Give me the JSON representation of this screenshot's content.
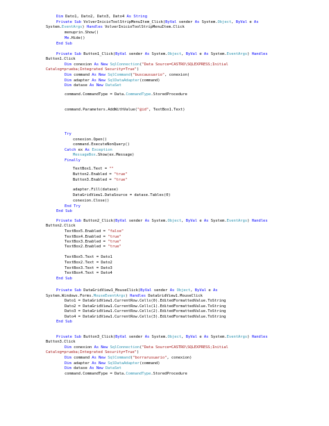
{
  "colors": {
    "background": "#ffffff",
    "plain": "#000000",
    "keyword": "#0000ff",
    "type": "#2b91af",
    "string": "#a31515"
  },
  "code": {
    "lines": [
      [
        {
          "k": "k",
          "t": "Dim"
        },
        {
          "k": "p",
          "t": " Dato1, Dato2, Dato3, Dato4 "
        },
        {
          "k": "k",
          "t": "As String"
        }
      ],
      [
        {
          "k": "k",
          "t": "Private Sub"
        },
        {
          "k": "p",
          "t": " VolverInicioToolStripMenuItem_Click("
        },
        {
          "k": "k",
          "t": "ByVal"
        },
        {
          "k": "p",
          "t": " sender "
        },
        {
          "k": "k",
          "t": "As"
        },
        {
          "k": "p",
          "t": " System."
        },
        {
          "k": "t",
          "t": "Object"
        },
        {
          "k": "p",
          "t": ", "
        },
        {
          "k": "k",
          "t": "ByVal"
        },
        {
          "k": "p",
          "t": " e "
        },
        {
          "k": "k",
          "t": "As"
        }
      ],
      [
        {
          "k": "p",
          "t": "System."
        },
        {
          "k": "t",
          "t": "EventArgs"
        },
        {
          "k": "p",
          "t": ") "
        },
        {
          "k": "k",
          "t": "Handles"
        },
        {
          "k": "p",
          "t": " VolverInicioToolStripMenuItem.Click"
        }
      ],
      [
        {
          "k": "p",
          "t": "menuprin.Show()"
        }
      ],
      [
        {
          "k": "k",
          "t": "Me"
        },
        {
          "k": "p",
          "t": ".Hide()"
        }
      ],
      [
        {
          "k": "k",
          "t": "End Sub"
        }
      ],
      [
        {
          "k": "k",
          "t": "Private Sub"
        },
        {
          "k": "p",
          "t": " Button1_Click("
        },
        {
          "k": "k",
          "t": "ByVal"
        },
        {
          "k": "p",
          "t": " sender "
        },
        {
          "k": "k",
          "t": "As"
        },
        {
          "k": "p",
          "t": " System."
        },
        {
          "k": "t",
          "t": "Object"
        },
        {
          "k": "p",
          "t": ", "
        },
        {
          "k": "k",
          "t": "ByVal"
        },
        {
          "k": "p",
          "t": " e "
        },
        {
          "k": "k",
          "t": "As"
        },
        {
          "k": "p",
          "t": " System."
        },
        {
          "k": "t",
          "t": "EventArgs"
        },
        {
          "k": "p",
          "t": ") "
        },
        {
          "k": "k",
          "t": "Handles"
        }
      ],
      [
        {
          "k": "p",
          "t": "Button1.Click"
        }
      ],
      [
        {
          "k": "k",
          "t": "Dim"
        },
        {
          "k": "p",
          "t": " conexion "
        },
        {
          "k": "k",
          "t": "As New"
        },
        {
          "k": "p",
          "t": " "
        },
        {
          "k": "t",
          "t": "SqlConnection"
        },
        {
          "k": "p",
          "t": "("
        },
        {
          "k": "s",
          "t": "\"Data Source=CASTRO\\SQLEXPRESS;Initial"
        }
      ],
      [
        {
          "k": "s",
          "t": "Catalog=prueba;Integrated Security=True\""
        },
        {
          "k": "p",
          "t": ")"
        }
      ],
      [
        {
          "k": "k",
          "t": "Dim"
        },
        {
          "k": "p",
          "t": " command "
        },
        {
          "k": "k",
          "t": "As New"
        },
        {
          "k": "p",
          "t": " "
        },
        {
          "k": "t",
          "t": "SqlCommand"
        },
        {
          "k": "p",
          "t": "("
        },
        {
          "k": "s",
          "t": "\"buscausuario\""
        },
        {
          "k": "p",
          "t": ", conexion)"
        }
      ],
      [
        {
          "k": "k",
          "t": "Dim"
        },
        {
          "k": "p",
          "t": " adapter "
        },
        {
          "k": "k",
          "t": "As New"
        },
        {
          "k": "p",
          "t": " "
        },
        {
          "k": "t",
          "t": "SqlDataAdapter"
        },
        {
          "k": "p",
          "t": "(command)"
        }
      ],
      [
        {
          "k": "k",
          "t": "Dim"
        },
        {
          "k": "p",
          "t": " datase "
        },
        {
          "k": "k",
          "t": "As New"
        },
        {
          "k": "p",
          "t": " "
        },
        {
          "k": "t",
          "t": "DataSet"
        }
      ],
      [
        {
          "k": "p",
          "t": "command.CommandType = Data."
        },
        {
          "k": "t",
          "t": "CommandType"
        },
        {
          "k": "p",
          "t": ".StoredProcedure"
        }
      ],
      [
        {
          "k": "p",
          "t": "command.Parameters.AddWithValue("
        },
        {
          "k": "s",
          "t": "\"@id\""
        },
        {
          "k": "p",
          "t": ", TextBox1.Text)"
        }
      ],
      [
        {
          "k": "k",
          "t": "Try"
        }
      ],
      [
        {
          "k": "p",
          "t": "conexion.Open()"
        }
      ],
      [
        {
          "k": "p",
          "t": "command.ExecuteNonQuery()"
        }
      ],
      [
        {
          "k": "k",
          "t": "Catch"
        },
        {
          "k": "p",
          "t": " ex "
        },
        {
          "k": "k",
          "t": "As"
        },
        {
          "k": "p",
          "t": " "
        },
        {
          "k": "t",
          "t": "Exception"
        }
      ],
      [
        {
          "k": "t",
          "t": "MessageBox"
        },
        {
          "k": "p",
          "t": ".Show(ex.Message)"
        }
      ],
      [
        {
          "k": "k",
          "t": "Finally"
        }
      ],
      [
        {
          "k": "p",
          "t": "TextBox1.Text = "
        },
        {
          "k": "s",
          "t": "\"\""
        }
      ],
      [
        {
          "k": "p",
          "t": "Button2.Enabled = "
        },
        {
          "k": "s",
          "t": "\"true\""
        }
      ],
      [
        {
          "k": "p",
          "t": "Button3.Enabled = "
        },
        {
          "k": "s",
          "t": "\"true\""
        }
      ],
      [
        {
          "k": "p",
          "t": "adapter.Fill(datase)"
        }
      ],
      [
        {
          "k": "p",
          "t": "DataGridView1.DataSource = datase.Tables(0)"
        }
      ],
      [
        {
          "k": "p",
          "t": "conexion.Close()"
        }
      ],
      [
        {
          "k": "k",
          "t": "End Try"
        }
      ],
      [
        {
          "k": "k",
          "t": "End Sub"
        }
      ],
      [
        {
          "k": "k",
          "t": "Private Sub"
        },
        {
          "k": "p",
          "t": " Button2_Click("
        },
        {
          "k": "k",
          "t": "ByVal"
        },
        {
          "k": "p",
          "t": " sender "
        },
        {
          "k": "k",
          "t": "As"
        },
        {
          "k": "p",
          "t": " System."
        },
        {
          "k": "t",
          "t": "Object"
        },
        {
          "k": "p",
          "t": ", "
        },
        {
          "k": "k",
          "t": "ByVal"
        },
        {
          "k": "p",
          "t": " e "
        },
        {
          "k": "k",
          "t": "As"
        },
        {
          "k": "p",
          "t": " System."
        },
        {
          "k": "t",
          "t": "EventArgs"
        },
        {
          "k": "p",
          "t": ") "
        },
        {
          "k": "k",
          "t": "Handles"
        }
      ],
      [
        {
          "k": "p",
          "t": "Button2.Click"
        }
      ],
      [
        {
          "k": "p",
          "t": "TextBox5.Enabled = "
        },
        {
          "k": "s",
          "t": "\"false\""
        }
      ],
      [
        {
          "k": "p",
          "t": "TextBox4.Enabled = "
        },
        {
          "k": "s",
          "t": "\"true\""
        }
      ],
      [
        {
          "k": "p",
          "t": "TextBox3.Enabled = "
        },
        {
          "k": "s",
          "t": "\"true\""
        }
      ],
      [
        {
          "k": "p",
          "t": "TextBox2.Enabled = "
        },
        {
          "k": "s",
          "t": "\"true\""
        }
      ],
      [
        {
          "k": "p",
          "t": "TextBox5.Text = Dato1"
        }
      ],
      [
        {
          "k": "p",
          "t": "TextBox2.Text = Dato2"
        }
      ],
      [
        {
          "k": "p",
          "t": "TextBox3.Text = Dato3"
        }
      ],
      [
        {
          "k": "p",
          "t": "TextBox4.Text = Dato4"
        }
      ],
      [
        {
          "k": "k",
          "t": "End Sub"
        }
      ],
      [
        {
          "k": "k",
          "t": "Private Sub"
        },
        {
          "k": "p",
          "t": " DataGridView1_MouseClick("
        },
        {
          "k": "k",
          "t": "ByVal"
        },
        {
          "k": "p",
          "t": " sender "
        },
        {
          "k": "k",
          "t": "As"
        },
        {
          "k": "p",
          "t": " "
        },
        {
          "k": "t",
          "t": "Object"
        },
        {
          "k": "p",
          "t": ", "
        },
        {
          "k": "k",
          "t": "ByVal"
        },
        {
          "k": "p",
          "t": " e "
        },
        {
          "k": "k",
          "t": "As"
        }
      ],
      [
        {
          "k": "p",
          "t": "System.Windows.Forms."
        },
        {
          "k": "t",
          "t": "MouseEventArgs"
        },
        {
          "k": "p",
          "t": ") "
        },
        {
          "k": "k",
          "t": "Handles"
        },
        {
          "k": "p",
          "t": " DataGridView1.MouseClick"
        }
      ],
      [
        {
          "k": "p",
          "t": "Dato1 = DataGridView1.CurrentRow.Cells(0).EditedFormattedValue.ToString"
        }
      ],
      [
        {
          "k": "p",
          "t": "Dato2 = DataGridView1.CurrentRow.Cells(1).EditedFormattedValue.ToString"
        }
      ],
      [
        {
          "k": "p",
          "t": "Dato3 = DataGridView1.CurrentRow.Cells(2).EditedFormattedValue.ToString"
        }
      ],
      [
        {
          "k": "p",
          "t": "Dato4 = DataGridView1.CurrentRow.Cells(3).EditedFormattedValue.ToString"
        }
      ],
      [
        {
          "k": "k",
          "t": "End Sub"
        }
      ],
      [
        {
          "k": "k",
          "t": "Private Sub"
        },
        {
          "k": "p",
          "t": " Button3_Click("
        },
        {
          "k": "k",
          "t": "ByVal"
        },
        {
          "k": "p",
          "t": " sender "
        },
        {
          "k": "k",
          "t": "As"
        },
        {
          "k": "p",
          "t": " System."
        },
        {
          "k": "t",
          "t": "Object"
        },
        {
          "k": "p",
          "t": ", "
        },
        {
          "k": "k",
          "t": "ByVal"
        },
        {
          "k": "p",
          "t": " e "
        },
        {
          "k": "k",
          "t": "As"
        },
        {
          "k": "p",
          "t": " System."
        },
        {
          "k": "t",
          "t": "EventArgs"
        },
        {
          "k": "p",
          "t": ") "
        },
        {
          "k": "k",
          "t": "Handles"
        }
      ],
      [
        {
          "k": "p",
          "t": "Button3.Click"
        }
      ],
      [
        {
          "k": "k",
          "t": "Dim"
        },
        {
          "k": "p",
          "t": " conexion "
        },
        {
          "k": "k",
          "t": "As New"
        },
        {
          "k": "p",
          "t": " "
        },
        {
          "k": "t",
          "t": "SqlConnection"
        },
        {
          "k": "p",
          "t": "("
        },
        {
          "k": "s",
          "t": "\"Data Source=CASTRO\\SQLEXPRESS;Initial"
        }
      ],
      [
        {
          "k": "s",
          "t": "Catalog=prueba;Integrated Security=True\""
        },
        {
          "k": "p",
          "t": ")"
        }
      ],
      [
        {
          "k": "k",
          "t": "Dim"
        },
        {
          "k": "p",
          "t": " command "
        },
        {
          "k": "k",
          "t": "As New"
        },
        {
          "k": "p",
          "t": " "
        },
        {
          "k": "t",
          "t": "SqlCommand"
        },
        {
          "k": "p",
          "t": "("
        },
        {
          "k": "s",
          "t": "\"borrarusuario\""
        },
        {
          "k": "p",
          "t": ", conexion)"
        }
      ],
      [
        {
          "k": "k",
          "t": "Dim"
        },
        {
          "k": "p",
          "t": " adapter "
        },
        {
          "k": "k",
          "t": "As New"
        },
        {
          "k": "p",
          "t": " "
        },
        {
          "k": "t",
          "t": "SqlDataAdapter"
        },
        {
          "k": "p",
          "t": "(command)"
        }
      ],
      [
        {
          "k": "k",
          "t": "Dim"
        },
        {
          "k": "p",
          "t": " datase "
        },
        {
          "k": "k",
          "t": "As New"
        },
        {
          "k": "p",
          "t": " "
        },
        {
          "k": "t",
          "t": "DataSet"
        }
      ],
      [
        {
          "k": "p",
          "t": "command.CommandType = Data."
        },
        {
          "k": "t",
          "t": "CommandType"
        },
        {
          "k": "p",
          "t": ".StoredProcedure"
        }
      ]
    ]
  }
}
